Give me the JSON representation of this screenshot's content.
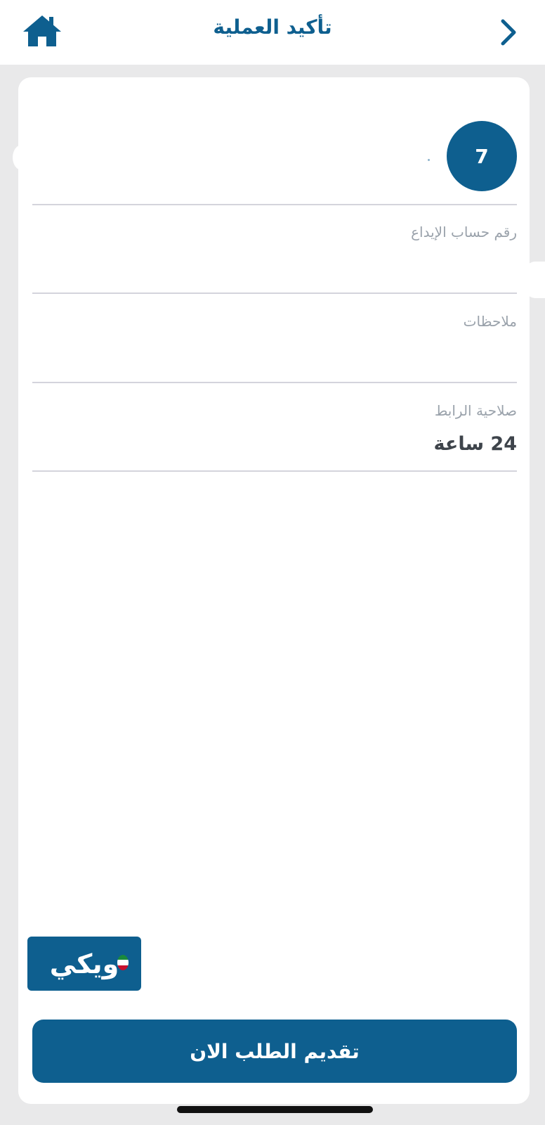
{
  "header": {
    "title": "تأكيد العملية",
    "home_icon": "home-icon",
    "back_icon": "chevron-right-icon"
  },
  "step": {
    "number": "7"
  },
  "fields": [
    {
      "label": "رقم حساب الإيداع",
      "value": ""
    },
    {
      "label": "ملاحظات",
      "value": ""
    },
    {
      "label": "صلاحية الرابط",
      "value": "24 ساعة"
    }
  ],
  "logo": {
    "text": "ويكي"
  },
  "actions": {
    "submit_label": "تقديم الطلب الان"
  },
  "colors": {
    "primary": "#0e5f8f",
    "background": "#e9e9ea",
    "card": "#ffffff",
    "label": "#9aa2ab",
    "divider": "#d4d4dc"
  }
}
